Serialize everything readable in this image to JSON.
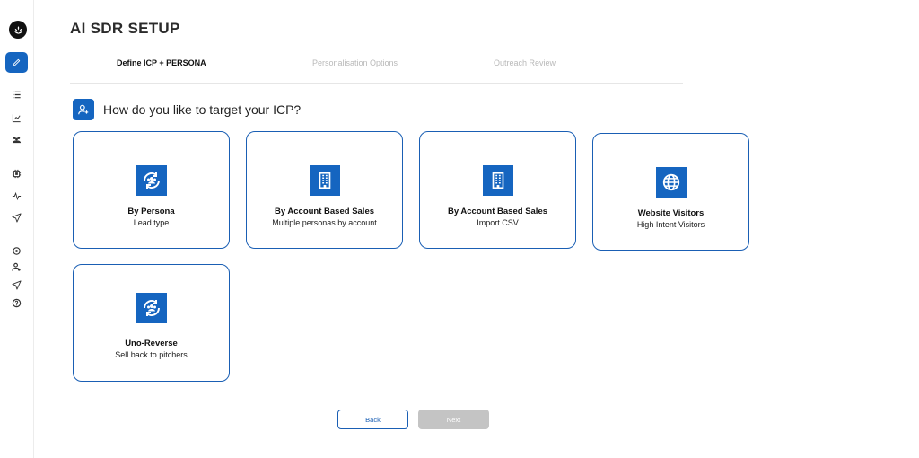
{
  "page": {
    "title": "AI SDR SETUP"
  },
  "stepper": {
    "steps": [
      {
        "label": "Define ICP + PERSONA",
        "active": true
      },
      {
        "label": "Personalisation Options",
        "active": false
      },
      {
        "label": "Outreach Review",
        "active": false
      }
    ]
  },
  "question": {
    "text": "How do you like to target your ICP?",
    "icon": "add-user-icon"
  },
  "cards": [
    {
      "title": "By Persona",
      "subtitle": "Lead type",
      "icon": "persona-cycle-icon"
    },
    {
      "title": "By Account Based Sales",
      "subtitle": "Multiple personas by account",
      "icon": "building-icon"
    },
    {
      "title": "By Account Based Sales",
      "subtitle": "Import CSV",
      "icon": "building-icon"
    },
    {
      "title": "Website Visitors",
      "subtitle": "High Intent Visitors",
      "icon": "globe-icon"
    },
    {
      "title": "Uno-Reverse",
      "subtitle": "Sell back to pitchers",
      "icon": "persona-cycle-icon"
    }
  ],
  "buttons": {
    "back": "Back",
    "next": "Next"
  },
  "sidebar": {
    "items": [
      {
        "icon": "logo-icon"
      },
      {
        "icon": "pencil-icon",
        "active": true
      },
      {
        "icon": "list-icon"
      },
      {
        "icon": "chart-icon"
      },
      {
        "icon": "users-icon"
      },
      {
        "icon": "cpu-icon"
      },
      {
        "icon": "activity-icon"
      },
      {
        "icon": "send-icon"
      },
      {
        "icon": "settings-icon"
      },
      {
        "icon": "user-settings-icon"
      },
      {
        "icon": "send-icon"
      },
      {
        "icon": "help-icon"
      }
    ]
  },
  "colors": {
    "accent": "#1565c0",
    "card_border": "#1a5fb4",
    "disabled": "#c4c4c4"
  }
}
